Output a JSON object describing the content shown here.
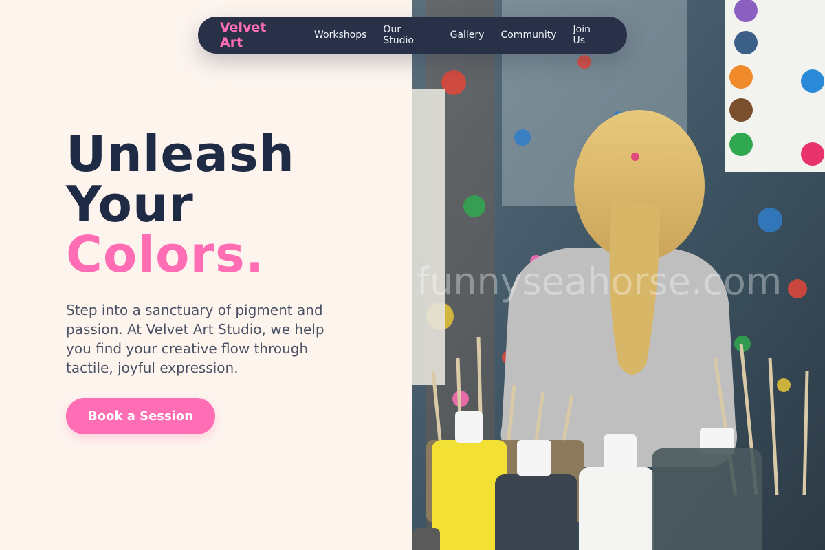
{
  "nav": {
    "brand": "Velvet Art",
    "links": [
      "Workshops",
      "Our Studio",
      "Gallery",
      "Community",
      "Join Us"
    ]
  },
  "hero": {
    "line1": "Unleash",
    "line2": "Your",
    "accent": "Colors.",
    "description": "Step into a sanctuary of pigment and passion. At Velvet Art Studio, we help you find your creative flow through tactile, joyful expression.",
    "cta": "Book a Session"
  },
  "photo": {
    "watermark": "funnyseahorse.com"
  },
  "colors": {
    "accent": "#ff6eb4",
    "navy": "#1f2a44",
    "background": "#fdf4ee"
  }
}
